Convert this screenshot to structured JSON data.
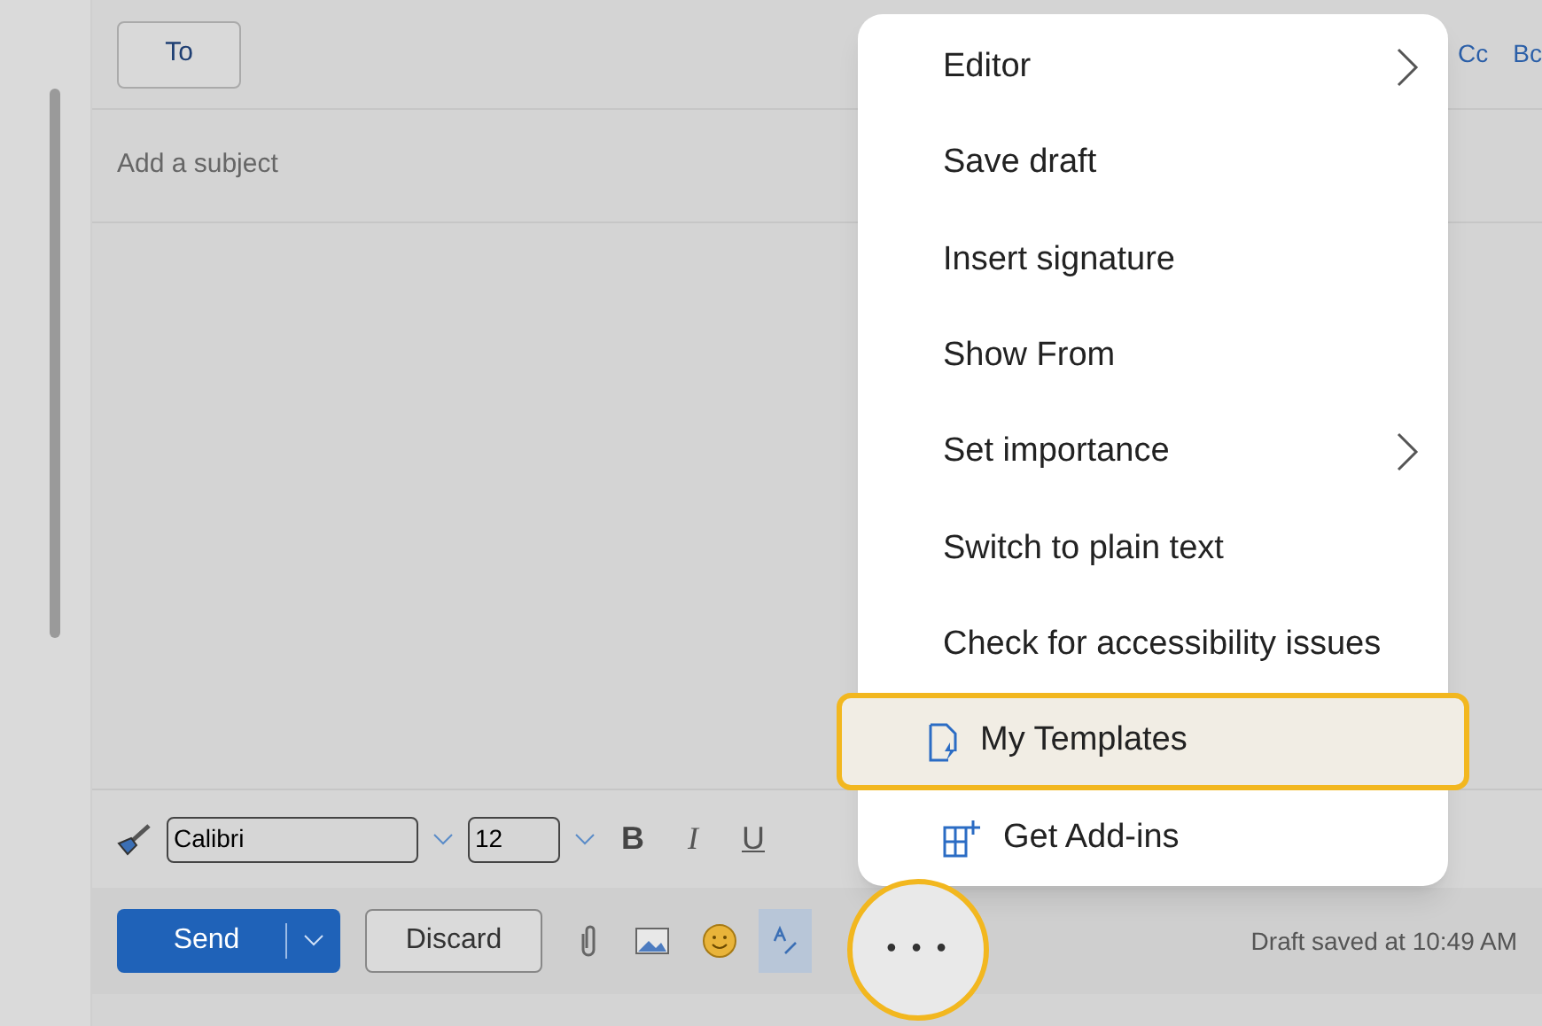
{
  "recipients": {
    "to_button": "To",
    "cc": "Cc",
    "bcc": "Bc"
  },
  "subject": {
    "placeholder": "Add a subject"
  },
  "format_bar": {
    "font": "Calibri",
    "size": "12",
    "bold": "B",
    "italic": "I",
    "underline": "U"
  },
  "actions": {
    "send": "Send",
    "discard": "Discard",
    "more": "• • •",
    "status": "Draft saved at 10:49 AM"
  },
  "menu": [
    {
      "label": "Editor",
      "kind": "submenu",
      "selected": false
    },
    {
      "label": "Save draft",
      "kind": "text",
      "selected": false
    },
    {
      "label": "Insert signature",
      "kind": "text",
      "selected": false
    },
    {
      "label": "Show From",
      "kind": "text",
      "selected": false
    },
    {
      "label": "Set importance",
      "kind": "submenu",
      "selected": false
    },
    {
      "label": "Switch to plain text",
      "kind": "text",
      "selected": false
    },
    {
      "label": "Check for accessibility issues",
      "kind": "text",
      "selected": false
    },
    {
      "label": "My Templates",
      "kind": "template",
      "selected": true
    },
    {
      "label": "Get Add-ins",
      "kind": "addin",
      "selected": false
    }
  ]
}
